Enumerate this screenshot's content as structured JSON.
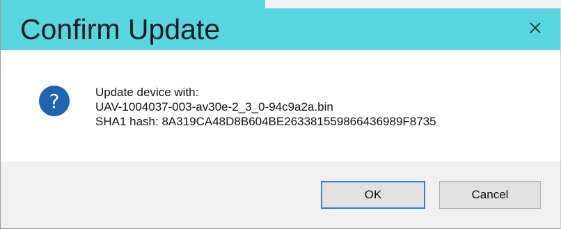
{
  "dialog": {
    "title": "Confirm Update",
    "close_icon": "close-icon",
    "message_icon": "question-icon",
    "message_lines": [
      "Update device with:",
      "UAV-1004037-003-av30e-2_3_0-94c9a2a.bin",
      "SHA1 hash: 8A319CA48D8B604BE263381559866436989F8735"
    ],
    "buttons": {
      "ok_label": "OK",
      "cancel_label": "Cancel"
    }
  },
  "colors": {
    "titlebar": "#57d6e0",
    "icon_blue": "#1d5fa8",
    "default_button_border": "#2f7fd6",
    "footer": "#f0f0f0"
  }
}
